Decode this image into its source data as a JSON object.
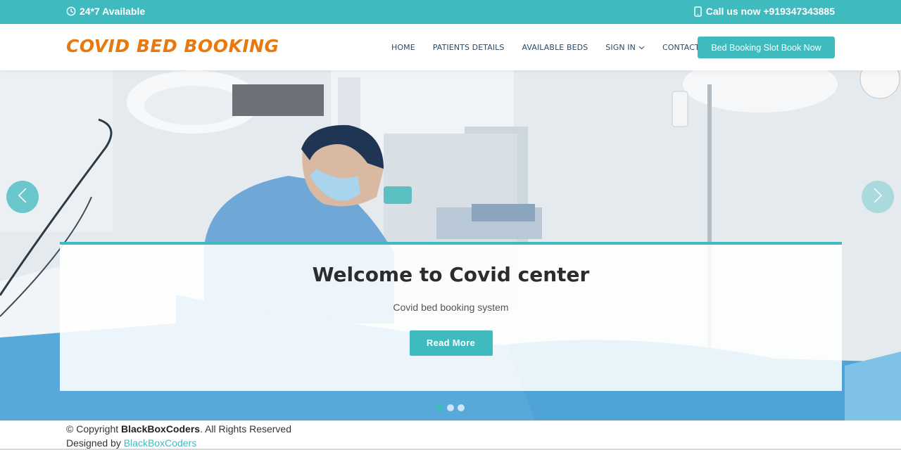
{
  "topbar": {
    "availability": "24*7 Available",
    "phone": "Call us now +919347343885",
    "clock_icon": "clock-icon",
    "phone_icon": "phone-icon",
    "color": "#3fbbc0"
  },
  "header": {
    "logo": "COVID BED BOOKING",
    "logo_color": "#e8790f",
    "nav": [
      {
        "label": "HOME"
      },
      {
        "label": "PATIENTS DETAILS"
      },
      {
        "label": "AVAILABLE BEDS"
      },
      {
        "label": "SIGN IN"
      },
      {
        "label": "CONTACT"
      }
    ],
    "cta": "Bed Booking Slot Book Now"
  },
  "hero": {
    "title": "Welcome to Covid center",
    "subtitle": "Covid bed booking system",
    "button": "Read More",
    "slide_count": 3,
    "active_slide": 1
  },
  "footer": {
    "copyright_prefix": "© Copyright",
    "brand": "BlackBoxCoders",
    "rights": ". All Rights Reserved",
    "designed_by": "Designed by",
    "designer": "BlackBoxCoders"
  }
}
